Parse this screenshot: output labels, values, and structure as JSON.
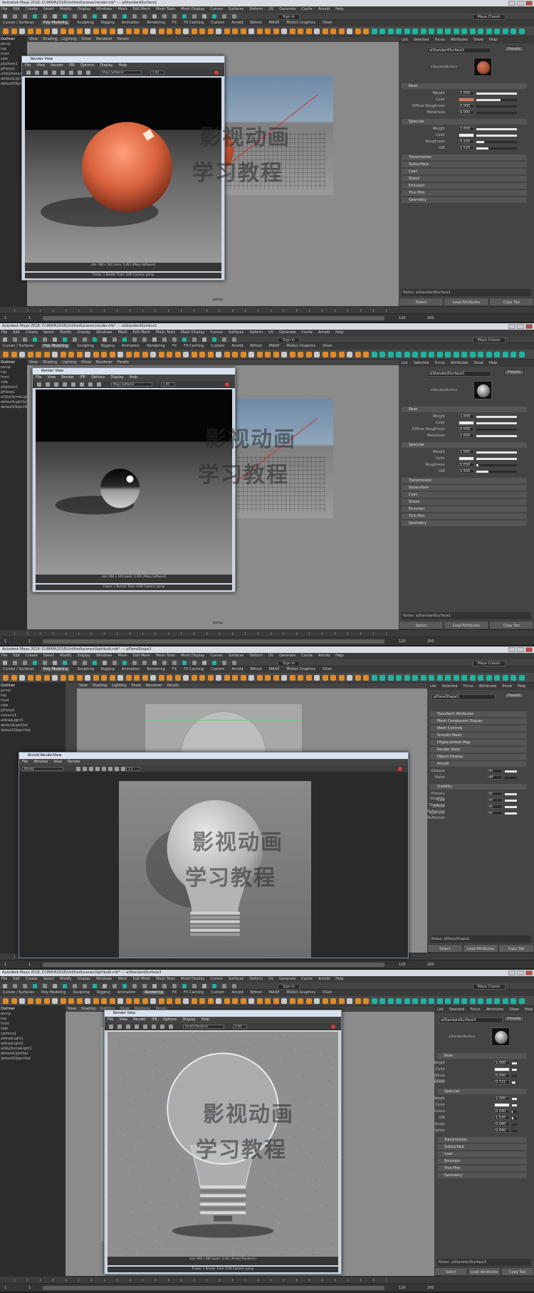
{
  "watermark": {
    "line1": "影视动画",
    "line2": "学习教程"
  },
  "panels": [
    {
      "title": "Autodesk Maya 2018: D:\\MAYA2018\\Untitled\\scenes\\render.mb* --- aiStandardSurface1",
      "menus": [
        "File",
        "Edit",
        "Create",
        "Select",
        "Modify",
        "Display",
        "Windows",
        "Mesh",
        "Edit Mesh",
        "Mesh Tools",
        "Mesh Display",
        "Curves",
        "Surfaces",
        "Deform",
        "UV",
        "Generate",
        "Cache",
        "Arnold",
        "Help"
      ],
      "shelf_tabs": [
        "Curves / Surfaces",
        "Poly Modeling",
        "Sculpting",
        "Rigging",
        "Animation",
        "Rendering",
        "FX",
        "FX Caching",
        "Custom",
        "Arnold",
        "Bifrost",
        "MASH",
        "Motion Graphics",
        "XGen"
      ],
      "active_shelf": "Poly Modeling",
      "sign_in": "Sign In",
      "workspace": "Maya Classic",
      "outliner_title": "Outliner",
      "outliner_items": [
        "persp",
        "top",
        "front",
        "side",
        "pSphere1",
        "pPlane1",
        "aiSkyDomeLight1",
        "defaultLightSet",
        "defaultObjectSet"
      ],
      "viewport_menus": [
        "View",
        "Shading",
        "Lighting",
        "Show",
        "Renderer",
        "Panels"
      ],
      "camera_label": "persp",
      "attr_tabs": [
        "List",
        "Selected",
        "Focus",
        "Attributes",
        "Show",
        "Help"
      ],
      "node_name": "aiStandardSurface1",
      "preset_button": "Presets",
      "swatch_caption": "aiStandardSurface",
      "sections": [
        {
          "name": "Base",
          "rows": [
            {
              "label": "Weight",
              "value": "1.000",
              "fill": 1.0
            },
            {
              "label": "Color",
              "value": "",
              "fill": 0.6
            },
            {
              "label": "Diffuse Roughness",
              "value": "0.000",
              "fill": 0.0
            },
            {
              "label": "Metalness",
              "value": "0.000",
              "fill": 0.0
            }
          ]
        },
        {
          "name": "Specular",
          "rows": [
            {
              "label": "Weight",
              "value": "1.000",
              "fill": 1.0
            },
            {
              "label": "Color",
              "value": "",
              "fill": 1.0
            },
            {
              "label": "Roughness",
              "value": "0.200",
              "fill": 0.2
            },
            {
              "label": "IOR",
              "value": "1.520",
              "fill": 0.3
            }
          ]
        }
      ],
      "extra_sections": [
        "Transmission",
        "Subsurface",
        "Coat",
        "Sheen",
        "Emission",
        "Thin Film",
        "Geometry"
      ],
      "notes_label": "Notes: aiStandardSurface1",
      "bottom_buttons": [
        "Select",
        "Load Attributes",
        "Copy Tab"
      ],
      "range": {
        "start": "1",
        "end": "120",
        "end2": "200",
        "current": "1"
      },
      "render": {
        "title": "Render View",
        "menus": [
          "File",
          "View",
          "Render",
          "IPR",
          "Options",
          "Display",
          "Help"
        ],
        "renderer": "Maya Software",
        "zoom": "1.00",
        "status": "size: 960 x 540 zoom: 0.491 (Maya Software)",
        "status2": "Frame: 1 Render Time: 0:00 Camera: persp",
        "subject": "orange-sphere"
      }
    },
    {
      "title": "Autodesk Maya 2018: D:\\MAYA2018\\Untitled\\scenes\\render.mb* --- aiStandardSurface1",
      "menus": [
        "File",
        "Edit",
        "Create",
        "Select",
        "Modify",
        "Display",
        "Windows",
        "Mesh",
        "Edit Mesh",
        "Mesh Tools",
        "Mesh Display",
        "Curves",
        "Surfaces",
        "Deform",
        "UV",
        "Generate",
        "Cache",
        "Arnold",
        "Help"
      ],
      "shelf_tabs": [
        "Curves / Surfaces",
        "Poly Modeling",
        "Sculpting",
        "Rigging",
        "Animation",
        "Rendering",
        "FX",
        "FX Caching",
        "Custom",
        "Arnold",
        "Bifrost",
        "MASH",
        "Motion Graphics",
        "XGen"
      ],
      "active_shelf": "Poly Modeling",
      "sign_in": "Sign In",
      "workspace": "Maya Classic",
      "outliner_title": "Outliner",
      "outliner_items": [
        "persp",
        "top",
        "front",
        "side",
        "pSphere1",
        "pPlane1",
        "aiSkyDomeLight1",
        "defaultLightSet",
        "defaultObjectSet"
      ],
      "viewport_menus": [
        "View",
        "Shading",
        "Lighting",
        "Show",
        "Renderer",
        "Panels"
      ],
      "camera_label": "persp",
      "attr_tabs": [
        "List",
        "Selected",
        "Focus",
        "Attributes",
        "Show",
        "Help"
      ],
      "node_name": "aiStandardSurface1",
      "preset_button": "Presets",
      "swatch_caption": "aiStandardSurface",
      "sections": [
        {
          "name": "Base",
          "rows": [
            {
              "label": "Weight",
              "value": "1.000",
              "fill": 1.0
            },
            {
              "label": "Color",
              "value": "",
              "fill": 1.0
            },
            {
              "label": "Diffuse Roughness",
              "value": "0.000",
              "fill": 0.0
            },
            {
              "label": "Metalness",
              "value": "1.000",
              "fill": 1.0
            }
          ]
        },
        {
          "name": "Specular",
          "rows": [
            {
              "label": "Weight",
              "value": "1.000",
              "fill": 1.0
            },
            {
              "label": "Color",
              "value": "",
              "fill": 1.0
            },
            {
              "label": "Roughness",
              "value": "0.050",
              "fill": 0.05
            },
            {
              "label": "IOR",
              "value": "1.500",
              "fill": 0.3
            }
          ]
        }
      ],
      "extra_sections": [
        "Transmission",
        "Subsurface",
        "Coat",
        "Sheen",
        "Emission",
        "Thin Film",
        "Geometry"
      ],
      "notes_label": "Notes: aiStandardSurface1",
      "bottom_buttons": [
        "Select",
        "Load Attributes",
        "Copy Tab"
      ],
      "range": {
        "start": "1",
        "end": "120",
        "end2": "200",
        "current": "1"
      },
      "render": {
        "title": "Render View",
        "menus": [
          "File",
          "View",
          "Render",
          "IPR",
          "Options",
          "Display",
          "Help"
        ],
        "renderer": "Maya Software",
        "zoom": "1.00",
        "status": "size: 960 x 540 zoom: 0.491 (Maya Software)",
        "status2": "Frame: 1 Render Time: 0:00 Camera: persp",
        "subject": "chrome-sphere"
      }
    },
    {
      "title": "Autodesk Maya 2018: D:\\MAYA2018\\Untitled\\scenes\\lightbulb.mb* --- pPlaneShape1",
      "menus": [
        "File",
        "Edit",
        "Create",
        "Select",
        "Modify",
        "Display",
        "Windows",
        "Mesh",
        "Edit Mesh",
        "Mesh Tools",
        "Mesh Display",
        "Curves",
        "Surfaces",
        "Deform",
        "UV",
        "Generate",
        "Cache",
        "Arnold",
        "Help"
      ],
      "shelf_tabs": [
        "Curves / Surfaces",
        "Poly Modeling",
        "Sculpting",
        "Rigging",
        "Animation",
        "Rendering",
        "FX",
        "FX Caching",
        "Custom",
        "Arnold",
        "Bifrost",
        "MASH",
        "Motion Graphics",
        "XGen"
      ],
      "active_shelf": "Poly Modeling",
      "sign_in": "Sign In",
      "workspace": "Maya Classic",
      "outliner_title": "Outliner",
      "outliner_items": [
        "persp",
        "top",
        "front",
        "side",
        "pPlane1",
        "camera1",
        "aiAreaLight1",
        "defaultLightSet",
        "defaultObjectSet"
      ],
      "viewport_menus": [
        "View",
        "Shading",
        "Lighting",
        "Show",
        "Renderer",
        "Panels"
      ],
      "camera_label": "persp",
      "attr_tabs": [
        "List",
        "Selected",
        "Focus",
        "Attributes",
        "Show",
        "Help"
      ],
      "node_name": "pPlaneShape1",
      "preset_button": "Presets",
      "swatch_caption": "",
      "sections": [
        {
          "name": "Arnold",
          "rows": [
            {
              "label": "Opaque",
              "value": "on",
              "fill": 1.0
            },
            {
              "label": "Matte",
              "value": "off",
              "fill": 0.0
            }
          ]
        },
        {
          "name": "Visibility",
          "rows": [
            {
              "label": "Primary Visibility",
              "value": "on",
              "fill": 1.0
            },
            {
              "label": "Cast Shadows",
              "value": "on",
              "fill": 1.0
            },
            {
              "label": "Diffuse Reflection",
              "value": "on",
              "fill": 1.0
            },
            {
              "label": "Specular Reflection",
              "value": "on",
              "fill": 1.0
            }
          ]
        }
      ],
      "extra_sections": [
        "Transform Attributes",
        "Mesh Component Display",
        "Mesh Controls",
        "Smooth Mesh",
        "Displacement Map",
        "Render Stats",
        "Object Display"
      ],
      "notes_label": "Notes: pPlaneShape1",
      "bottom_buttons": [
        "Select",
        "Load Attributes",
        "Copy Tab"
      ],
      "range": {
        "start": "1",
        "end": "120",
        "end2": "200",
        "current": "1"
      },
      "render": {
        "title": "Arnold RenderView",
        "menus": [
          "File",
          "Window",
          "View",
          "Render"
        ],
        "renderer": "Beauty",
        "zoom": "1:1",
        "status": "",
        "status2": "",
        "subject": "lightbulb-matte"
      }
    },
    {
      "title": "Autodesk Maya 2018: D:\\MAYA2018\\Untitled\\scenes\\lightbulb.mb* --- aiStandardSurface3",
      "menus": [
        "File",
        "Edit",
        "Create",
        "Select",
        "Modify",
        "Display",
        "Windows",
        "Mesh",
        "Edit Mesh",
        "Mesh Tools",
        "Mesh Display",
        "Curves",
        "Surfaces",
        "Deform",
        "UV",
        "Generate",
        "Cache",
        "Arnold",
        "Help"
      ],
      "shelf_tabs": [
        "Curves / Surfaces",
        "Poly Modeling",
        "Sculpting",
        "Rigging",
        "Animation",
        "Rendering",
        "FX",
        "FX Caching",
        "Custom",
        "Arnold",
        "Bifrost",
        "MASH",
        "Motion Graphics",
        "XGen"
      ],
      "active_shelf": "Rendering",
      "sign_in": "Sign In",
      "workspace": "Maya Classic",
      "outliner_title": "Outliner",
      "outliner_items": [
        "persp",
        "top",
        "front",
        "side",
        "camera1",
        "aiAreaLight1",
        "aiAreaLight2",
        "aiSkyDomeLight1",
        "defaultLightSet",
        "defaultObjectSet"
      ],
      "viewport_menus": [
        "View",
        "Shading",
        "Lighting",
        "Show",
        "Renderer",
        "Panels"
      ],
      "camera_label": "persp",
      "attr_tabs": [
        "List",
        "Selected",
        "Focus",
        "Attributes",
        "Show",
        "Help"
      ],
      "node_name": "aiStandardSurface3",
      "preset_button": "Presets",
      "swatch_caption": "aiStandardSurface",
      "sections": [
        {
          "name": "Base",
          "rows": [
            {
              "label": "Weight",
              "value": "1.000",
              "fill": 1.0
            },
            {
              "label": "Color",
              "value": "",
              "fill": 1.0
            },
            {
              "label": "Diffuse Roughness",
              "value": "0.000",
              "fill": 0.0
            },
            {
              "label": "Metalness",
              "value": "0.721",
              "fill": 0.72
            }
          ]
        },
        {
          "name": "Specular",
          "rows": [
            {
              "label": "Weight",
              "value": "1.000",
              "fill": 1.0
            },
            {
              "label": "Color",
              "value": "",
              "fill": 1.0
            },
            {
              "label": "Roughness",
              "value": "0.200",
              "fill": 0.2
            },
            {
              "label": "IOR",
              "value": "1.520",
              "fill": 0.3
            },
            {
              "label": "Anisotropy",
              "value": "0.000",
              "fill": 0.0
            },
            {
              "label": "Rotation",
              "value": "0.000",
              "fill": 0.0
            }
          ]
        }
      ],
      "extra_sections": [
        "Transmission",
        "Subsurface",
        "Coat",
        "Emission",
        "Thin Film",
        "Geometry"
      ],
      "notes_label": "Notes: aiStandardSurface3",
      "bottom_buttons": [
        "Select",
        "Load Attributes",
        "Copy Tab"
      ],
      "range": {
        "start": "1",
        "end": "120",
        "end2": "200",
        "current": "1"
      },
      "render": {
        "title": "Render View",
        "menus": [
          "File",
          "View",
          "Render",
          "IPR",
          "Options",
          "Display",
          "Help"
        ],
        "renderer": "Arnold Renderer",
        "zoom": "0.00",
        "status": "size: 960 x 960 zoom: 0.431 (Arnold Renderer)",
        "status2": "Frame: 1 Render Time: 0:28 Camera: persp",
        "subject": "lightbulb-glass"
      }
    }
  ],
  "colors": {
    "accent": "#e07a3c",
    "maya_bg": "#444444",
    "viewport": "#8b8b8b",
    "panel_dark": "#2b2b2b",
    "icon_orange": "#e08a2a",
    "icon_teal": "#1fb3a3"
  }
}
